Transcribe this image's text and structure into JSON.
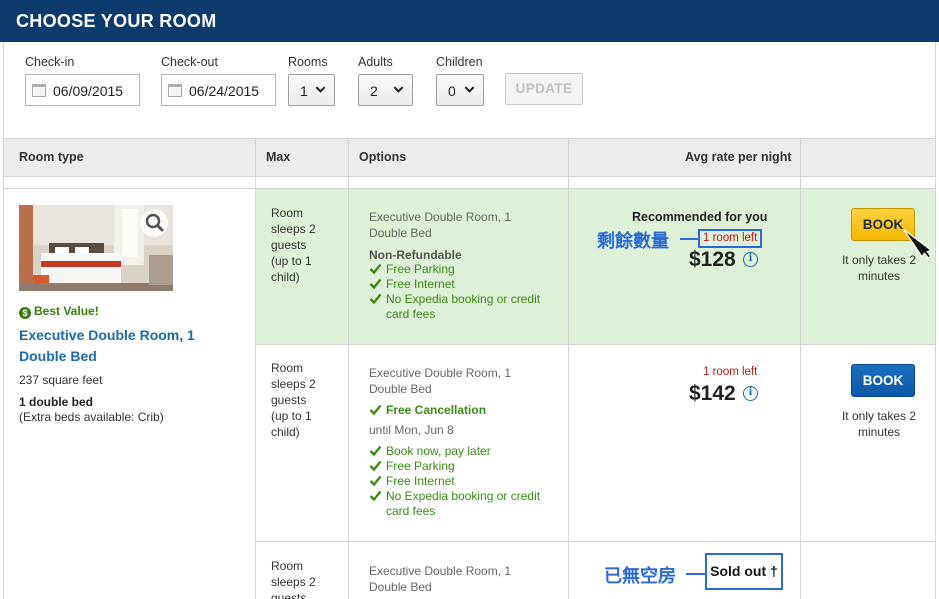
{
  "header": {
    "title": "CHOOSE YOUR ROOM"
  },
  "search": {
    "checkin_label": "Check-in",
    "checkin_value": "06/09/2015",
    "checkout_label": "Check-out",
    "checkout_value": "06/24/2015",
    "rooms_label": "Rooms",
    "rooms_value": "1",
    "adults_label": "Adults",
    "adults_value": "2",
    "children_label": "Children",
    "children_value": "0",
    "update_label": "UPDATE"
  },
  "table": {
    "columns": [
      "Room type",
      "Max",
      "Options",
      "Avg rate per night"
    ]
  },
  "room": {
    "best_value": "Best Value!",
    "best_value_icon": "$",
    "name_line1": "Executive Double Room, 1",
    "name_line2": "Double Bed",
    "size": "237 square feet",
    "beds": "1 double bed",
    "extra_beds": "(Extra beds available: Crib)"
  },
  "rates": [
    {
      "max": [
        "Room",
        "sleeps 2",
        "guests",
        "(up to 1",
        "child)"
      ],
      "room_title": [
        "Executive Double Room, 1",
        "Double Bed"
      ],
      "policy": "Non-Refundable",
      "features": [
        "Free Parking",
        "Free Internet",
        "No Expedia booking or credit",
        "card fees"
      ],
      "recommended": "Recommended for you",
      "rooms_left": "1 room left",
      "price": "$128",
      "book_label": "BOOK",
      "takes": [
        "It only takes 2",
        "minutes"
      ]
    },
    {
      "max": [
        "Room",
        "sleeps 2",
        "guests",
        "(up to 1",
        "child)"
      ],
      "room_title": [
        "Executive Double Room, 1",
        "Double Bed"
      ],
      "policy": "Free Cancellation",
      "until": "until Mon, Jun 8",
      "features": [
        "Book now, pay later",
        "Free Parking",
        "Free Internet",
        "No Expedia booking or credit",
        "card fees"
      ],
      "rooms_left": "1 room left",
      "price": "$142",
      "book_label": "BOOK",
      "takes": [
        "It only takes 2",
        "minutes"
      ]
    },
    {
      "max": [
        "Room",
        "sleeps 2",
        "guests"
      ],
      "room_title": [
        "Executive Double Room, 1",
        "Double Bed"
      ],
      "sold_out": "Sold out †"
    }
  ],
  "annotations": {
    "remaining": "剩餘數量",
    "sold_out": "已無空房"
  },
  "colors": {
    "header_bg": "#0b3a6b",
    "link_blue": "#1a6aad",
    "green_text": "#3a8c14",
    "green_row": "#dff0d8",
    "red_text": "#c0171b",
    "book_yellow": "#f5b800",
    "book_blue": "#0d58a6",
    "annotation_blue": "#2c6bd4"
  },
  "icons": [
    "calendar-icon",
    "chevron-down-icon",
    "zoom-icon",
    "dollar-icon",
    "check-icon",
    "info-icon",
    "cursor-arrow-icon"
  ]
}
